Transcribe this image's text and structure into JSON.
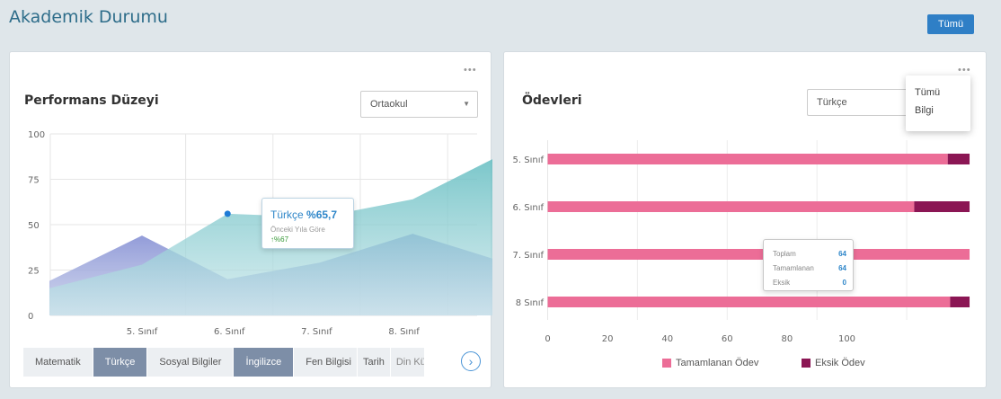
{
  "header": {
    "title": "Akademik Durumu",
    "all_button": "Tümü"
  },
  "performance": {
    "title": "Performans Düzeyi",
    "menu": "•••",
    "select_value": "Ortaokul",
    "select_arrow": "▼",
    "tooltip": {
      "subject": "Türkçe",
      "value": "%65,7",
      "compare_label": "Önceki Yıla Göre",
      "change": "↑%67"
    },
    "tabs": [
      "Matematik",
      "Türkçe",
      "Sosyal Bilgiler",
      "İngilizce",
      "Fen Bilgisi",
      "Tarih",
      "Din Kü"
    ],
    "next_icon": "›",
    "colors": {
      "area_front": "#6ec3c4",
      "area_back": "#8b95d6",
      "point": "#1e7bd6"
    }
  },
  "homework": {
    "title": "Ödevleri",
    "menu": "•••",
    "select_value": "Türkçe",
    "dropdown_items": [
      "Tümü",
      "Bilgi"
    ],
    "tooltip": {
      "rows": [
        {
          "label": "Toplam",
          "value": "64"
        },
        {
          "label": "Tamamlanan",
          "value": "64"
        },
        {
          "label": "Eksik",
          "value": "0"
        }
      ]
    },
    "legend": {
      "completed": "Tamamlanan Ödev",
      "missing": "Eksik Ödev"
    },
    "colors": {
      "completed": "#ec6d97",
      "missing": "#8b1654"
    }
  },
  "chart_data": [
    {
      "type": "area",
      "title": "Performans Düzeyi",
      "categories": [
        "5. Sınıf",
        "6. Sınıf",
        "7. Sınıf",
        "8. Sınıf"
      ],
      "ylim": [
        0,
        100
      ],
      "yticks": [
        0,
        25,
        50,
        75,
        100
      ],
      "grid": true,
      "series": [
        {
          "name": "Türkçe",
          "x": [
            -1.06,
            0,
            0.98,
            2.03,
            3.1,
            4.3
          ],
          "values": [
            15,
            28,
            56,
            54,
            64,
            93
          ]
        },
        {
          "x": [
            -1.06,
            0,
            0.98,
            2.03,
            3.1,
            4.3
          ],
          "values": [
            19,
            44,
            20,
            29,
            45,
            27
          ]
        }
      ]
    },
    {
      "type": "bar",
      "orientation": "horizontal",
      "stacked": true,
      "title": "Ödevleri",
      "categories": [
        "5. Sınıf",
        "6. Sınıf",
        "7. Sınıf",
        "8 Sınıf"
      ],
      "xticks": [
        0,
        20,
        40,
        60,
        80,
        100
      ],
      "xlim": [
        0,
        141
      ],
      "series": [
        {
          "name": "Tamamlanan Ödev",
          "values": [
            133.7,
            122.5,
            141,
            134.5
          ]
        },
        {
          "name": "Eksik Ödev",
          "values": [
            7.3,
            18.5,
            0,
            6.5
          ]
        }
      ],
      "legend": "bottom"
    }
  ]
}
